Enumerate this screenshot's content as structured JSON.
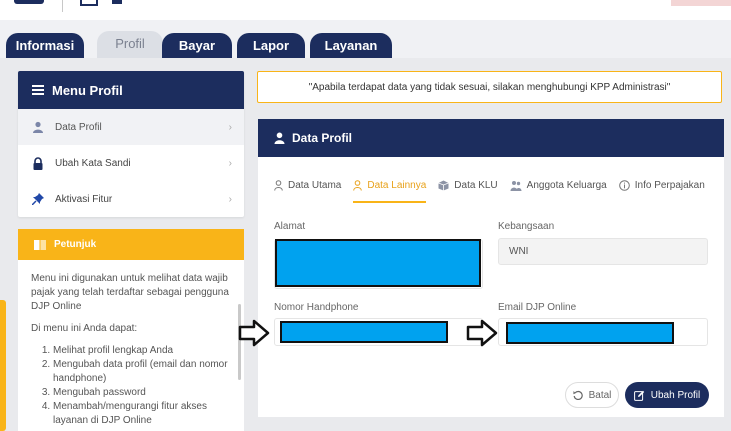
{
  "tabs": [
    {
      "label": "Informasi",
      "active": true
    },
    {
      "label": "Profil",
      "active": false
    },
    {
      "label": "Bayar",
      "active": true
    },
    {
      "label": "Lapor",
      "active": true
    },
    {
      "label": "Layanan",
      "active": true
    }
  ],
  "menu": {
    "title": "Menu Profil",
    "items": [
      {
        "label": "Data Profil",
        "icon": "user-icon"
      },
      {
        "label": "Ubah Kata Sandi",
        "icon": "lock-icon"
      },
      {
        "label": "Aktivasi Fitur",
        "icon": "pin-icon"
      }
    ]
  },
  "hint": {
    "title": "Petunjuk",
    "paragraph1": "Menu ini digunakan untuk melihat data wajib pajak yang telah terdaftar sebagai pengguna DJP Online",
    "paragraph2": "Di menu ini Anda dapat:",
    "list": [
      "Melihat profil lengkap Anda",
      "Mengubah data profil (email dan nomor handphone)",
      "Mengubah password",
      "Menambah/mengurangi fitur akses layanan di DJP Online"
    ]
  },
  "notice": "\"Apabila terdapat data yang tidak sesuai, silakan menghubungi KPP Administrasi\"",
  "profile": {
    "title": "Data Profil",
    "subtabs": [
      {
        "label": "Data Utama",
        "icon": "user-outline-icon"
      },
      {
        "label": "Data Lainnya",
        "icon": "user-outline-icon"
      },
      {
        "label": "Data KLU",
        "icon": "box-icon"
      },
      {
        "label": "Anggota Keluarga",
        "icon": "family-icon"
      },
      {
        "label": "Info Perpajakan",
        "icon": "info-icon"
      }
    ],
    "fields": {
      "alamat_label": "Alamat",
      "kebangsaan_label": "Kebangsaan",
      "kebangsaan_value": "WNI",
      "handphone_label": "Nomor Handphone",
      "email_label": "Email DJP Online"
    },
    "buttons": {
      "cancel": "Batal",
      "submit": "Ubah Profil"
    }
  },
  "colors": {
    "navy": "#1c2d5e",
    "amber": "#f9b418",
    "redaction": "#00a2ef"
  }
}
